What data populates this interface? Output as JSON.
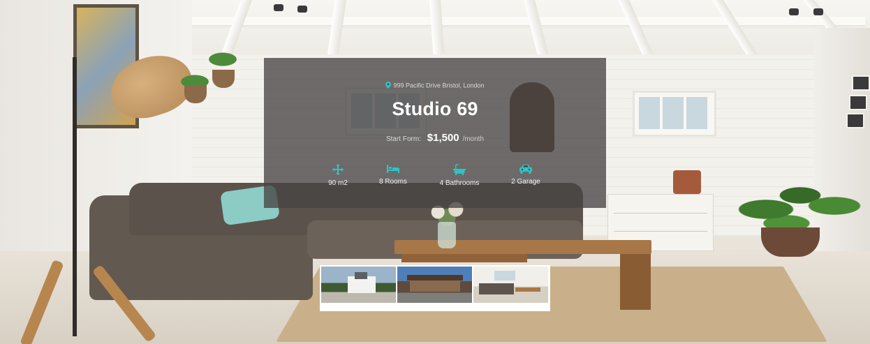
{
  "listing": {
    "address": "999 Pacific Drive Bristol, London",
    "title": "Studio 69",
    "price_prefix": "Start Form:",
    "price": "$1,500",
    "price_period": "/month"
  },
  "features": [
    {
      "icon": "arrows-move-icon",
      "label": "90 m2"
    },
    {
      "icon": "bed-icon",
      "label": "8 Rooms"
    },
    {
      "icon": "bathtub-icon",
      "label": "4 Bathrooms"
    },
    {
      "icon": "car-icon",
      "label": "2 Garage"
    }
  ],
  "thumbnails": [
    {
      "name": "thumbnail-house-1"
    },
    {
      "name": "thumbnail-house-2"
    },
    {
      "name": "thumbnail-living-room"
    }
  ],
  "colors": {
    "accent": "#2ec4c4",
    "overlay": "#464444"
  }
}
